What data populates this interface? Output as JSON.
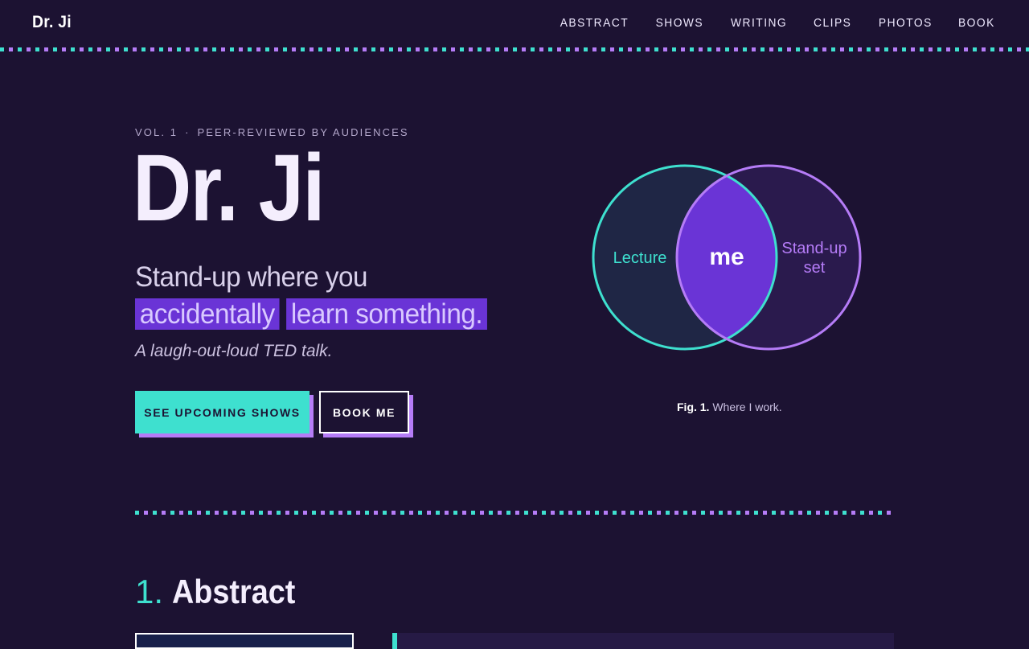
{
  "site": {
    "logo": "Dr. Ji"
  },
  "nav": {
    "items": [
      {
        "label": "ABSTRACT"
      },
      {
        "label": "SHOWS"
      },
      {
        "label": "WRITING"
      },
      {
        "label": "CLIPS"
      },
      {
        "label": "PHOTOS"
      },
      {
        "label": "BOOK"
      }
    ]
  },
  "hero": {
    "kicker_left": "VOL. 1",
    "kicker_sep": "·",
    "kicker_right": "PEER-REVIEWED BY AUDIENCES",
    "title": "Dr. Ji",
    "tagline_pre": "Stand-up where you",
    "tagline_hl1": "accidentally",
    "tagline_hl2": "learn something.",
    "subtagline": "A laugh-out-loud TED talk.",
    "primary_cta": "SEE UPCOMING SHOWS",
    "secondary_cta": "BOOK ME"
  },
  "figure": {
    "left_label": "Lecture",
    "center_label": "me",
    "right_label_line1": "Stand-up",
    "right_label_line2": "set",
    "caption_bold": "Fig. 1.",
    "caption_text": "Where I work."
  },
  "section": {
    "number": "1.",
    "title": "Abstract"
  },
  "colors": {
    "background": "#1c1232",
    "teal_accent": "#3ee0cf",
    "purple_accent": "#b57cf7",
    "highlight": "#6a34d6"
  }
}
